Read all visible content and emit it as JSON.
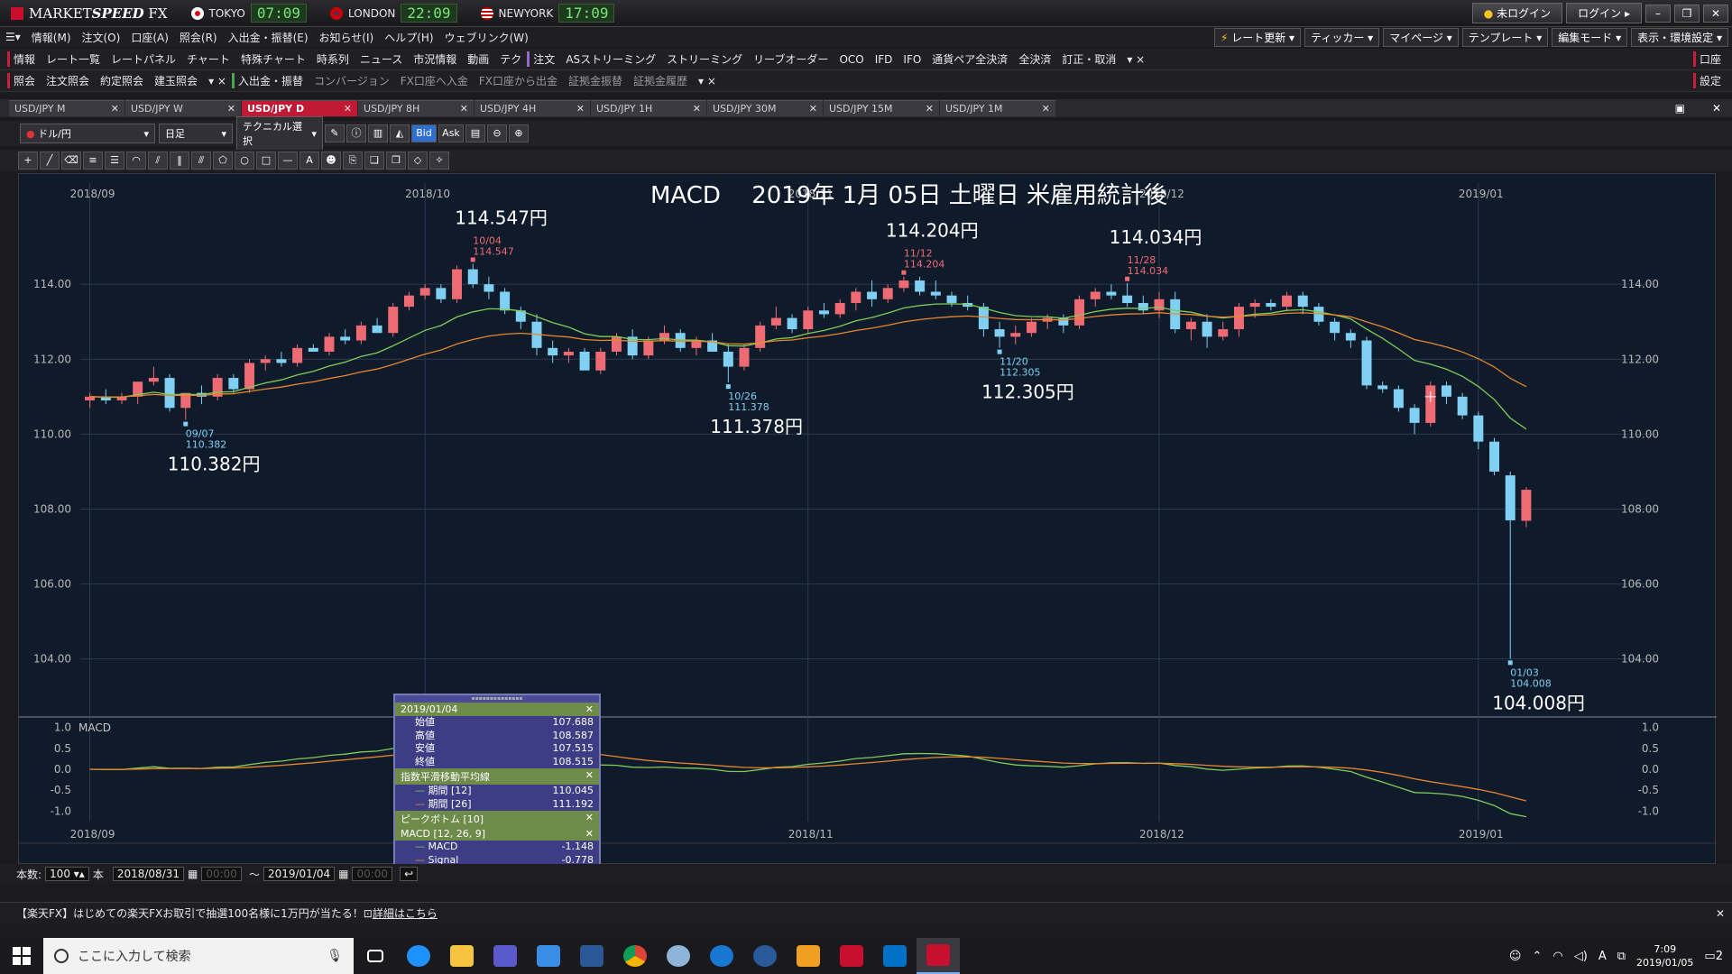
{
  "app": {
    "name_light": "MARKET",
    "name_bold": "SPEED",
    "name_suffix": " FX",
    "clocks": [
      {
        "city": "TOKYO",
        "time": "07:09"
      },
      {
        "city": "LONDON",
        "time": "22:09"
      },
      {
        "city": "NEWYORK",
        "time": "17:09"
      }
    ],
    "status": "未ログイン",
    "login": "ログイン"
  },
  "menu": {
    "items": [
      "情報(M)",
      "注文(O)",
      "口座(A)",
      "照会(R)",
      "入出金・振替(E)",
      "お知らせ(I)",
      "ヘルプ(H)",
      "ウェブリンク(W)"
    ],
    "right": [
      "レート更新",
      "ティッカー",
      "マイページ",
      "テンプレート",
      "編集モード",
      "表示・環境設定"
    ]
  },
  "toolbar1": {
    "group1": "情報",
    "items1": [
      "レート一覧",
      "レートパネル",
      "チャート",
      "特殊チャート",
      "時系列",
      "ニュース",
      "市況情報",
      "動画",
      "テク"
    ],
    "group2": "注文",
    "items2": [
      "ASストリーミング",
      "ストリーミング",
      "リーブオーダー",
      "OCO",
      "IFD",
      "IFO",
      "通貨ペア全決済",
      "全決済",
      "訂正・取消"
    ],
    "right": "口座"
  },
  "toolbar2": {
    "group1": "照会",
    "items1": [
      "注文照会",
      "約定照会",
      "建玉照会"
    ],
    "group2": "入出金・振替",
    "items2": [
      "コンバージョン",
      "FX口座へ入金",
      "FX口座から出金",
      "証拠金振替",
      "証拠金履歴"
    ],
    "right": "設定"
  },
  "tabs": [
    "USD/JPY M",
    "USD/JPY W",
    "USD/JPY D",
    "USD/JPY 8H",
    "USD/JPY 4H",
    "USD/JPY 1H",
    "USD/JPY 30M",
    "USD/JPY 15M",
    "USD/JPY 1M"
  ],
  "active_tab": 2,
  "controls": {
    "pair": "ドル/円",
    "period": "日足",
    "technical": "テクニカル選択",
    "bid": "Bid",
    "ask": "Ask"
  },
  "chart_data": {
    "type": "candlestick",
    "title": "MACD　 2019年 1月 05日 土曜日 米雇用統計後",
    "ylim": [
      102.5,
      116.7
    ],
    "yticks": [
      104.0,
      106.0,
      108.0,
      110.0,
      112.0,
      114.0
    ],
    "xticks": [
      {
        "label": "2018/09",
        "index": 0
      },
      {
        "label": "2018/10",
        "index": 21
      },
      {
        "label": "2018/11",
        "index": 45
      },
      {
        "label": "2018/12",
        "index": 67
      },
      {
        "label": "2019/01",
        "index": 87
      }
    ],
    "candles": [
      [
        110.9,
        111.1,
        110.7,
        111.0
      ],
      [
        111.0,
        111.2,
        110.8,
        110.9
      ],
      [
        110.9,
        111.1,
        110.8,
        111.0
      ],
      [
        111.0,
        111.4,
        110.8,
        111.4
      ],
      [
        111.4,
        111.8,
        111.3,
        111.5
      ],
      [
        111.5,
        111.6,
        110.6,
        110.7
      ],
      [
        110.7,
        110.9,
        110.38,
        111.1
      ],
      [
        111.1,
        111.3,
        110.8,
        111.0
      ],
      [
        111.0,
        111.6,
        110.9,
        111.5
      ],
      [
        111.5,
        111.6,
        111.1,
        111.2
      ],
      [
        111.2,
        112.0,
        111.1,
        111.9
      ],
      [
        111.9,
        112.1,
        111.7,
        112.0
      ],
      [
        112.0,
        112.2,
        111.8,
        111.9
      ],
      [
        111.9,
        112.4,
        111.8,
        112.3
      ],
      [
        112.3,
        112.4,
        112.2,
        112.2
      ],
      [
        112.2,
        112.7,
        112.1,
        112.6
      ],
      [
        112.6,
        112.8,
        112.4,
        112.5
      ],
      [
        112.5,
        113.0,
        112.4,
        112.9
      ],
      [
        112.9,
        113.1,
        112.7,
        112.7
      ],
      [
        112.7,
        113.5,
        112.6,
        113.4
      ],
      [
        113.4,
        113.8,
        113.3,
        113.7
      ],
      [
        113.7,
        114.0,
        113.6,
        113.9
      ],
      [
        113.9,
        114.0,
        113.5,
        113.6
      ],
      [
        113.6,
        114.5,
        113.5,
        114.4
      ],
      [
        114.4,
        114.547,
        113.9,
        114.0
      ],
      [
        114.0,
        114.2,
        113.6,
        113.8
      ],
      [
        113.8,
        113.9,
        113.2,
        113.3
      ],
      [
        113.3,
        113.4,
        112.8,
        113.0
      ],
      [
        113.0,
        113.2,
        112.1,
        112.3
      ],
      [
        112.3,
        112.5,
        111.9,
        112.1
      ],
      [
        112.1,
        112.3,
        111.9,
        112.2
      ],
      [
        112.2,
        112.3,
        111.8,
        111.7
      ],
      [
        111.7,
        112.3,
        111.6,
        112.2
      ],
      [
        112.2,
        112.7,
        112.1,
        112.6
      ],
      [
        112.6,
        112.8,
        112.0,
        112.1
      ],
      [
        112.1,
        112.6,
        112.0,
        112.5
      ],
      [
        112.5,
        112.9,
        112.4,
        112.7
      ],
      [
        112.7,
        112.8,
        112.2,
        112.3
      ],
      [
        112.3,
        112.6,
        112.1,
        112.5
      ],
      [
        112.5,
        112.7,
        112.2,
        112.2
      ],
      [
        112.2,
        112.4,
        111.378,
        111.8
      ],
      [
        111.8,
        112.4,
        111.7,
        112.3
      ],
      [
        112.3,
        113.0,
        112.2,
        112.9
      ],
      [
        112.9,
        113.4,
        112.8,
        113.1
      ],
      [
        113.1,
        113.2,
        112.7,
        112.8
      ],
      [
        112.8,
        113.4,
        112.7,
        113.3
      ],
      [
        113.3,
        113.5,
        113.1,
        113.2
      ],
      [
        113.2,
        113.6,
        113.1,
        113.5
      ],
      [
        113.5,
        113.9,
        113.3,
        113.8
      ],
      [
        113.8,
        114.1,
        113.4,
        113.6
      ],
      [
        113.6,
        114.0,
        113.5,
        113.9
      ],
      [
        113.9,
        114.204,
        113.8,
        114.1
      ],
      [
        114.1,
        114.2,
        113.7,
        113.8
      ],
      [
        113.8,
        114.1,
        113.6,
        113.7
      ],
      [
        113.7,
        113.8,
        113.4,
        113.5
      ],
      [
        113.5,
        113.7,
        113.3,
        113.4
      ],
      [
        113.4,
        113.5,
        112.6,
        112.8
      ],
      [
        112.8,
        113.0,
        112.305,
        112.6
      ],
      [
        112.6,
        112.9,
        112.4,
        112.7
      ],
      [
        112.7,
        113.1,
        112.6,
        113.0
      ],
      [
        113.0,
        113.2,
        112.8,
        113.1
      ],
      [
        113.1,
        113.2,
        112.7,
        112.9
      ],
      [
        112.9,
        113.7,
        112.8,
        113.6
      ],
      [
        113.6,
        113.9,
        113.4,
        113.8
      ],
      [
        113.8,
        114.0,
        113.6,
        113.7
      ],
      [
        113.7,
        114.034,
        113.4,
        113.5
      ],
      [
        113.5,
        113.7,
        113.2,
        113.3
      ],
      [
        113.3,
        113.8,
        113.1,
        113.6
      ],
      [
        113.6,
        113.8,
        112.7,
        112.8
      ],
      [
        112.8,
        113.1,
        112.5,
        113.0
      ],
      [
        113.0,
        113.2,
        112.3,
        112.6
      ],
      [
        112.6,
        113.0,
        112.5,
        112.8
      ],
      [
        112.8,
        113.5,
        112.6,
        113.4
      ],
      [
        113.4,
        113.6,
        113.1,
        113.5
      ],
      [
        113.5,
        113.6,
        113.3,
        113.4
      ],
      [
        113.4,
        113.8,
        113.3,
        113.7
      ],
      [
        113.7,
        113.8,
        113.2,
        113.4
      ],
      [
        113.4,
        113.5,
        112.9,
        113.0
      ],
      [
        113.0,
        113.1,
        112.5,
        112.7
      ],
      [
        112.7,
        112.8,
        112.3,
        112.5
      ],
      [
        112.5,
        112.6,
        111.2,
        111.3
      ],
      [
        111.3,
        111.4,
        111.1,
        111.2
      ],
      [
        111.2,
        111.3,
        110.6,
        110.7
      ],
      [
        110.7,
        110.8,
        110.0,
        110.3
      ],
      [
        110.3,
        111.4,
        110.2,
        111.3
      ],
      [
        111.3,
        111.4,
        110.8,
        111.0
      ],
      [
        111.0,
        111.1,
        110.4,
        110.5
      ],
      [
        110.5,
        110.6,
        109.6,
        109.8
      ],
      [
        109.8,
        109.9,
        108.9,
        109.0
      ],
      [
        108.9,
        109.0,
        104.008,
        107.7
      ],
      [
        107.688,
        108.587,
        107.515,
        108.515
      ]
    ],
    "ema_series": [
      {
        "name": "期間 [12]",
        "period": 12,
        "color": "#7fcc5a"
      },
      {
        "name": "期間 [26]",
        "period": 26,
        "color": "#e8862e"
      }
    ],
    "annotations": [
      {
        "index": 6,
        "kind": "low",
        "date": "09/07",
        "value": "110.382",
        "big": "110.382円"
      },
      {
        "index": 24,
        "kind": "high",
        "date": "10/04",
        "value": "114.547",
        "big": "114.547円"
      },
      {
        "index": 40,
        "kind": "low",
        "date": "10/26",
        "value": "111.378",
        "big": "111.378円"
      },
      {
        "index": 51,
        "kind": "high",
        "date": "11/12",
        "value": "114.204",
        "big": "114.204円"
      },
      {
        "index": 57,
        "kind": "low",
        "date": "11/20",
        "value": "112.305",
        "big": "112.305円"
      },
      {
        "index": 65,
        "kind": "high",
        "date": "11/28",
        "value": "114.034",
        "big": "114.034円"
      },
      {
        "index": 89,
        "kind": "low",
        "date": "01/03",
        "value": "104.008",
        "big": "104.008円"
      }
    ],
    "macd": {
      "label": "MACD",
      "ylim": [
        -1.25,
        1.25
      ],
      "yticks": [
        1.0,
        0.5,
        0.0,
        -0.5,
        -1.0
      ],
      "macd_color": "#7fcc5a",
      "signal_color": "#e8862e"
    },
    "colors": {
      "up": "#ef6b74",
      "down": "#7fd0f2"
    }
  },
  "data_panel": {
    "date": "2019/01/04",
    "ohlc": [
      {
        "label": "始値",
        "value": "107.688"
      },
      {
        "label": "高値",
        "value": "108.587"
      },
      {
        "label": "安値",
        "value": "107.515"
      },
      {
        "label": "終値",
        "value": "108.515"
      }
    ],
    "ema_head": "指数平滑移動平均線",
    "ema": [
      {
        "label": "期間 [12]",
        "value": "110.045"
      },
      {
        "label": "期間 [26]",
        "value": "111.192"
      }
    ],
    "peak_head": "ピークボトム [10]",
    "macd_head": "MACD [12, 26, 9]",
    "macd": [
      {
        "label": "MACD",
        "value": "-1.148"
      },
      {
        "label": "Signal",
        "value": "-0.778"
      }
    ]
  },
  "statusbar": {
    "count_label": "本数:",
    "count": "100",
    "unit": "本",
    "from": "2018/08/31",
    "from_time": "00:00",
    "to": "2019/01/04",
    "to_time": "00:00"
  },
  "ad": {
    "text": "【楽天FX】はじめての楽天FXお取引で抽選100名様に1万円が当たる！",
    "link": "詳細はこちら"
  },
  "taskbar": {
    "search_placeholder": "ここに入力して検索",
    "time": "7:09",
    "date": "2019/01/05",
    "ime": "A",
    "notifications": "2"
  }
}
